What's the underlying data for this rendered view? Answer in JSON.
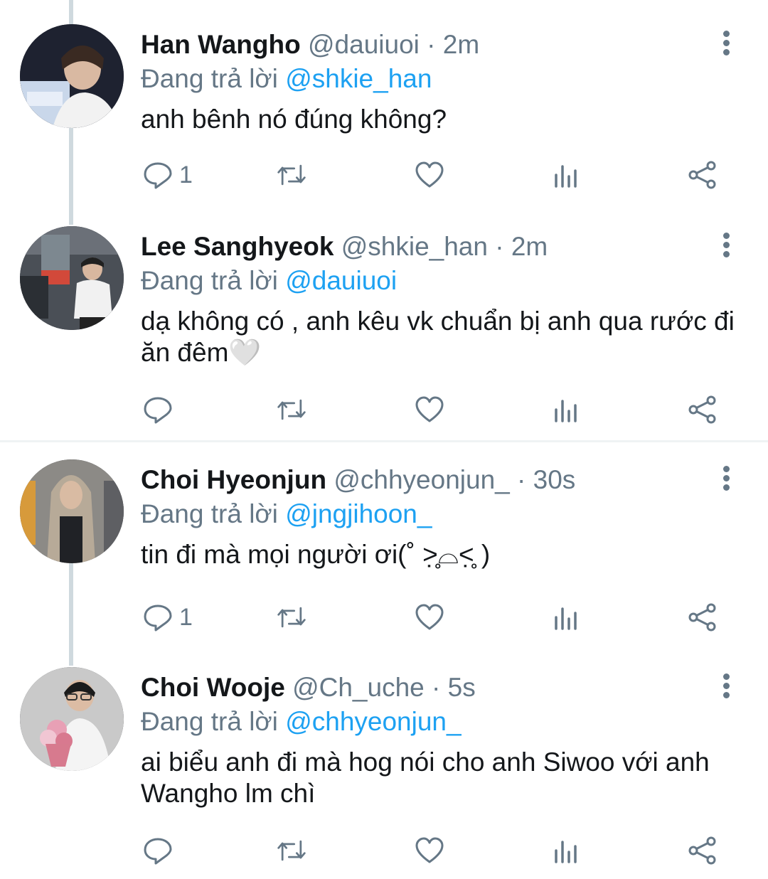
{
  "tweets": [
    {
      "name": "Han Wangho",
      "handle": "@dauiuoi",
      "sep": " · ",
      "time": "2m",
      "reply_prefix": "Đang trả lời ",
      "reply_to": "@shkie_han",
      "text": "anh bênh nó đúng không?",
      "reply_count": "1"
    },
    {
      "name": "Lee Sanghyeok",
      "handle": "@shkie_han",
      "sep": " · ",
      "time": "2m",
      "reply_prefix": "Đang trả lời ",
      "reply_to": "@dauiuoi",
      "text": "dạ không có , anh kêu vk chuẩn bị anh qua rước đi ăn đêm🤍",
      "reply_count": ""
    },
    {
      "name": "Choi Hyeonjun",
      "handle": "@chhyeonjun_",
      "sep": " · ",
      "time": "30s",
      "reply_prefix": "Đang trả lời ",
      "reply_to": "@jngjihoon_",
      "text": "tin đi mà mọi người ơi(˚ ˃̣̣̥⌓˂̣̣̥ )",
      "reply_count": "1"
    },
    {
      "name": "Choi Wooje",
      "handle": "@Ch_uche",
      "sep": " · ",
      "time": "5s",
      "reply_prefix": "Đang trả lời ",
      "reply_to": "@chhyeonjun_",
      "text": "ai biểu anh đi mà hog nói cho anh Siwoo với anh Wangho lm chì",
      "reply_count": ""
    }
  ],
  "icons": {
    "reply": "reply-icon",
    "retweet": "retweet-icon",
    "like": "heart-icon",
    "views": "views-icon",
    "share": "share-icon",
    "more": "more-vertical-icon"
  },
  "colors": {
    "mention": "#1da1f2",
    "secondary": "#657786",
    "thread_line": "#cfd9de"
  }
}
